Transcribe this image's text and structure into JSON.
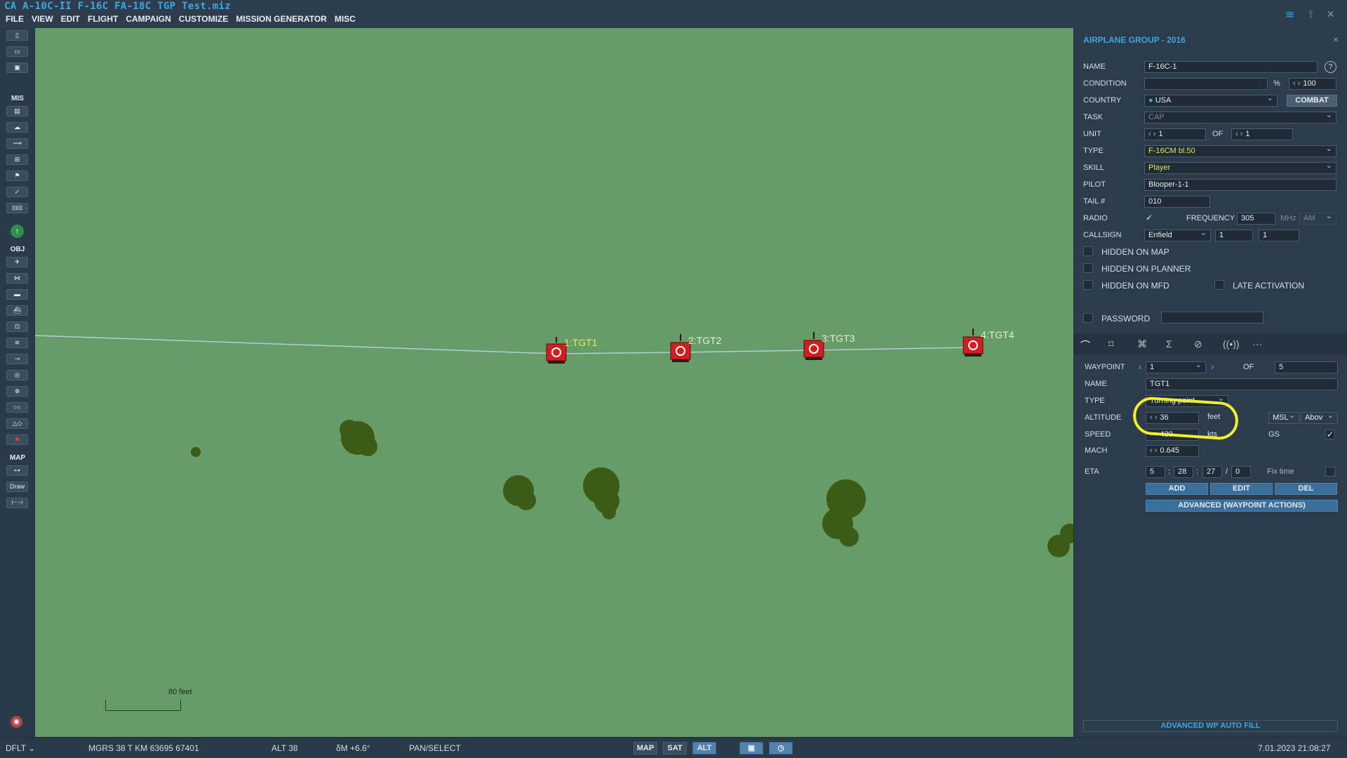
{
  "title": "CA A-10C-II F-16C FA-18C TGP Test.miz",
  "menu": [
    "FILE",
    "VIEW",
    "EDIT",
    "FLIGHT",
    "CAMPAIGN",
    "CUSTOMIZE",
    "MISSION GENERATOR",
    "MISC"
  ],
  "tray": {
    "wifi_icon": "wifi-icon",
    "antenna_icon": "antenna-icon",
    "close": "×"
  },
  "toolbar": {
    "sections": {
      "mis": "MIS",
      "obj": "OBJ",
      "map": "MAP"
    },
    "draw_label": "Draw"
  },
  "map": {
    "waypoints": [
      {
        "label": "1:TGT1",
        "highlight": true
      },
      {
        "label": "2:TGT2",
        "highlight": false
      },
      {
        "label": "3:TGT3",
        "highlight": false
      },
      {
        "label": "4:TGT4",
        "highlight": false
      }
    ],
    "scale_label": "80 feet"
  },
  "panel": {
    "title": "AIRPLANE GROUP - 2016",
    "close": "×",
    "help": "?",
    "labels": {
      "name": "NAME",
      "condition": "CONDITION",
      "country": "COUNTRY",
      "task": "TASK",
      "unit": "UNIT",
      "of": "OF",
      "type": "TYPE",
      "skill": "SKILL",
      "pilot": "PILOT",
      "tail": "TAIL #",
      "radio": "RADIO",
      "frequency": "FREQUENCY",
      "mhz": "MHz",
      "callsign": "CALLSIGN",
      "hidden_map": "HIDDEN ON MAP",
      "hidden_planner": "HIDDEN ON PLANNER",
      "hidden_mfd": "HIDDEN ON MFD",
      "late_activation": "LATE ACTIVATION",
      "password": "PASSWORD",
      "percent": "%"
    },
    "values": {
      "name": "F-16C-1",
      "condition": "100",
      "country": "USA",
      "combat": "COMBAT",
      "task": "CAP",
      "unit": "1",
      "unit_of": "1",
      "type": "F-16CM bl.50",
      "skill": "Player",
      "pilot": "Blooper-1-1",
      "tail": "010",
      "frequency": "305",
      "modulation": "AM",
      "callsign": "Enfield",
      "callsign_n1": "1",
      "callsign_n2": "1"
    },
    "waypoint": {
      "labels": {
        "waypoint": "WAYPOINT",
        "of": "OF",
        "name": "NAME",
        "type": "TYPE",
        "altitude": "ALTITUDE",
        "speed": "SPEED",
        "mach": "MACH",
        "eta": "ETA",
        "gs": "GS",
        "fix_time": "Fix time",
        "feet": "feet",
        "kts": "kts"
      },
      "index": "1",
      "total": "5",
      "name": "TGT1",
      "type": "Turning point",
      "altitude": "36",
      "alt_ref": "MSL",
      "alt_mode": "Abov",
      "speed": "430",
      "mach": "0.645",
      "eta": {
        "d": "5",
        "h": "28",
        "m": "27",
        "s": "0"
      },
      "add": "ADD",
      "edit": "EDIT",
      "del": "DEL",
      "advanced": "ADVANCED (WAYPOINT ACTIONS)",
      "auto_fill": "ADVANCED WP AUTO FILL"
    }
  },
  "status": {
    "profile": "DFLT",
    "mgrs": "MGRS  38 T KM 63695 67401",
    "alt": "ALT   38",
    "mag": "δM  +6.6°",
    "mode": "PAN/SELECT",
    "map_btn": "MAP",
    "sat_btn": "SAT",
    "alt_btn": "ALT",
    "datetime": "7.01.2023 21:08:27"
  }
}
